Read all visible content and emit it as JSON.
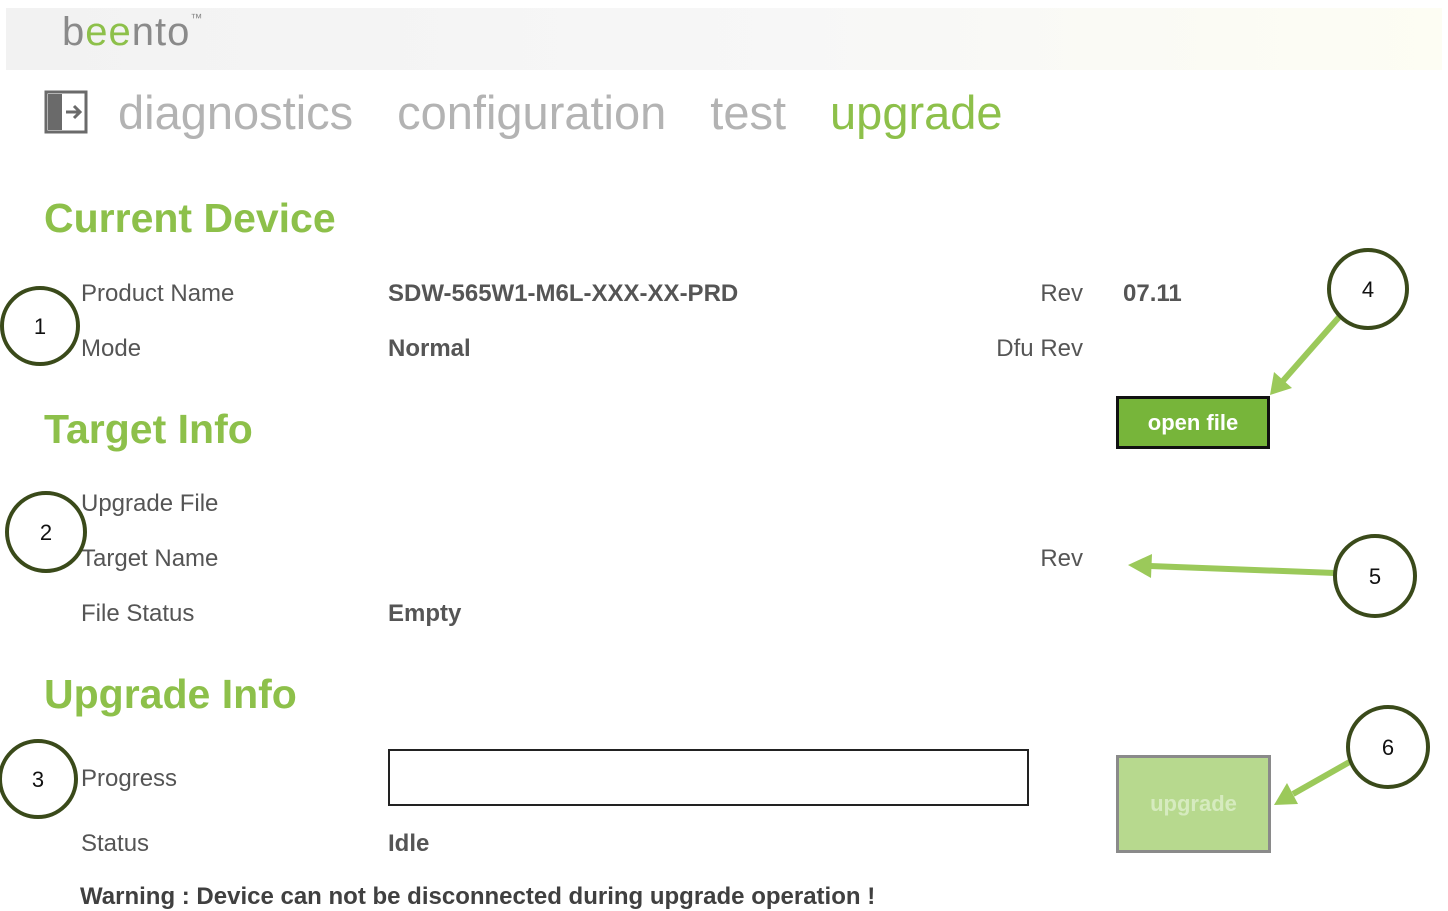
{
  "app": {
    "logo_left": "b",
    "logo_mid": "ee",
    "logo_right": "nto",
    "logo_tm": "™"
  },
  "nav": {
    "exit_icon": "exit-icon",
    "items": [
      "diagnostics",
      "configuration",
      "test",
      "upgrade"
    ],
    "active": "upgrade"
  },
  "current_device": {
    "title": "Current Device",
    "product_name_label": "Product Name",
    "product_name_value": "SDW-565W1-M6L-XXX-XX-PRD",
    "rev_label": "Rev",
    "rev_value": "07.11",
    "mode_label": "Mode",
    "mode_value": "Normal",
    "dfu_rev_label": "Dfu Rev",
    "dfu_rev_value": ""
  },
  "target_info": {
    "title": "Target Info",
    "upgrade_file_label": "Upgrade File",
    "upgrade_file_value": "",
    "target_name_label": "Target Name",
    "target_name_value": "",
    "rev_label": "Rev",
    "rev_value": "",
    "file_status_label": "File Status",
    "file_status_value": "Empty",
    "open_file_label": "open file"
  },
  "upgrade_info": {
    "title": "Upgrade Info",
    "progress_label": "Progress",
    "progress_fraction": 0,
    "status_label": "Status",
    "status_value": "Idle",
    "upgrade_button_label": "upgrade",
    "warning": "Warning : Device can not be disconnected during upgrade operation !"
  },
  "callouts": [
    "1",
    "2",
    "3",
    "4",
    "5",
    "6"
  ],
  "colors": {
    "accent": "#8dc04a",
    "button": "#77b53a",
    "disabled_button": "#b7d98e",
    "annotation_arrow": "#9bc95a",
    "annotation_circle": "#3a4a1a"
  }
}
